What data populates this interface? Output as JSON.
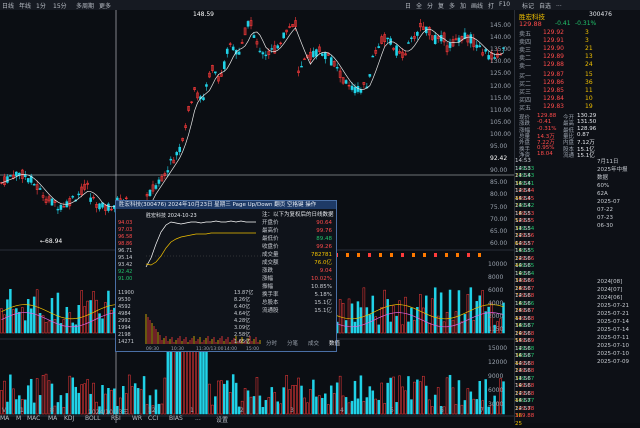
{
  "topbar": {
    "left_items": [
      "日线",
      "年线",
      "1分",
      "15分",
      "多周期",
      "更多"
    ],
    "right_items": [
      "日",
      "全",
      "分",
      "复",
      "多",
      "加",
      "画线",
      "打",
      "F10",
      "标记",
      "自选",
      "..."
    ]
  },
  "main": {
    "price_labels": [
      {
        "text": "148.59",
        "color": "#ffffff"
      },
      {
        "text": "68.94",
        "color": "#ffffff"
      }
    ],
    "axis_labels": [
      "145.00",
      "140.00",
      "135.00",
      "130.00",
      "125.00",
      "120.00",
      "115.00",
      "110.00",
      "105.00",
      "100.00",
      "95.00",
      "92.42",
      "90.00",
      "85.00",
      "80.00",
      "75.00",
      "70.00",
      "65.00",
      "60.00"
    ],
    "vol_axis_labels": [
      "10000",
      "8000",
      "6000",
      "4000",
      "2000",
      "1150"
    ],
    "vol2_axis_labels": [
      "15000",
      "12000",
      "9000",
      "6000",
      "3000"
    ],
    "bottom_labels": [
      "V",
      "1",
      "8",
      "2024/10/23三",
      "12",
      "1",
      "2",
      "3",
      "4",
      "5",
      "6",
      "7"
    ],
    "bottom_tabs": [
      "MA",
      "M",
      "MAC",
      "MA",
      "KDJ",
      "BOLL",
      "RSI",
      "WR",
      "CCI",
      "BIAS",
      "...",
      "设置"
    ]
  },
  "popup": {
    "title": "胜宏科技(300476) 2024年10月23日 星期三 Page Up/Down 翻页 空格键 操作",
    "chart_title": "胜宏科技  2024-10-23",
    "notice": "注：以下为复权后的日线数据",
    "left_values": [
      "94.03",
      "97.03",
      "96.58",
      "98.86",
      "96.71",
      "95.14",
      "93.42",
      "92.42",
      "91.00"
    ],
    "vol_values": [
      "11900",
      "9530",
      "4592",
      "4984",
      "2992",
      "1994",
      "2198",
      "14271"
    ],
    "vol_right": [
      "13.87亿",
      "8.26亿",
      "6.40亿",
      "4.64亿",
      "4.28亿",
      "3.09亿",
      "2.58亿",
      "1.65亿"
    ],
    "x_labels": [
      "09:30",
      "10:30",
      "11:30/13:00",
      "14:00",
      "15:00"
    ],
    "fields": [
      {
        "k": "开盘价",
        "v": "90.64",
        "color": "#ff4b4b"
      },
      {
        "k": "最高价",
        "v": "99.76",
        "color": "#ff4b4b"
      },
      {
        "k": "最低价",
        "v": "89.48",
        "color": "#21c36b"
      },
      {
        "k": "收盘价",
        "v": "99.26",
        "color": "#ff4b4b"
      },
      {
        "k": "成交量",
        "v": "782781",
        "color": "#f0c000"
      },
      {
        "k": "成交额",
        "v": "76.0亿",
        "color": "#f0c000"
      },
      {
        "k": "涨跌",
        "v": "9.04",
        "color": "#ff4b4b"
      },
      {
        "k": "涨幅",
        "v": "10.02%",
        "color": "#ff4b4b"
      },
      {
        "k": "振幅",
        "v": "10.85%",
        "color": "#c8ccd2"
      },
      {
        "k": "换手率",
        "v": "5.18%",
        "color": "#c8ccd2"
      },
      {
        "k": "总股本",
        "v": "15.1亿",
        "color": "#c8ccd2"
      },
      {
        "k": "流通股",
        "v": "15.1亿",
        "color": "#c8ccd2"
      }
    ],
    "tabs": [
      "分时",
      "分笔",
      "成交",
      "数值"
    ]
  },
  "right": {
    "name": "胜宏科技",
    "code": "300476",
    "price": "129.88",
    "change": "-0.41",
    "change_pct": "-0.31%",
    "sells": [
      {
        "l": "卖五",
        "p": "129.92",
        "q": "3"
      },
      {
        "l": "卖四",
        "p": "129.91",
        "q": "3"
      },
      {
        "l": "卖三",
        "p": "129.90",
        "q": "21"
      },
      {
        "l": "卖二",
        "p": "129.89",
        "q": "13"
      },
      {
        "l": "卖一",
        "p": "129.88",
        "q": "24"
      }
    ],
    "buys": [
      {
        "l": "买一",
        "p": "129.87",
        "q": "15"
      },
      {
        "l": "买二",
        "p": "129.86",
        "q": "36"
      },
      {
        "l": "买三",
        "p": "129.85",
        "q": "11"
      },
      {
        "l": "买四",
        "p": "129.84",
        "q": "10"
      },
      {
        "l": "买五",
        "p": "129.83",
        "q": "19"
      }
    ],
    "stats": [
      {
        "k": "现价",
        "v": "129.88",
        "k2": "今开",
        "v2": "130.29"
      },
      {
        "k": "涨跌",
        "v": "-0.41",
        "k2": "最高",
        "v2": "131.50"
      },
      {
        "k": "涨幅",
        "v": "-0.31%",
        "k2": "最低",
        "v2": "128.96"
      },
      {
        "k": "总量",
        "v": "14.3万",
        "k2": "量比",
        "v2": "0.87"
      },
      {
        "k": "外盘",
        "v": "7.22万",
        "k2": "内盘",
        "v2": "7.12万"
      },
      {
        "k": "换手",
        "v": "0.95%",
        "k2": "股本",
        "v2": "15.1亿"
      },
      {
        "k": "净资",
        "v": "18.04",
        "k2": "流通",
        "v2": "15.1亿"
      }
    ],
    "trades": [
      {
        "t": "14:53",
        "p": "129.83",
        "v": "21",
        "c": "#21c36b"
      },
      {
        "t": "14:53",
        "p": "129.83",
        "v": "38",
        "c": "#21c36b"
      },
      {
        "t": "14:54",
        "p": "129.81",
        "v": "12",
        "c": "#21c36b"
      },
      {
        "t": "14:54",
        "p": "129.84",
        "v": "45",
        "c": "#ff4b4b"
      },
      {
        "t": "14:54",
        "p": "129.85",
        "v": "23",
        "c": "#ff4b4b"
      },
      {
        "t": "14:54",
        "p": "129.82",
        "v": "18",
        "c": "#21c36b"
      },
      {
        "t": "14:54",
        "p": "129.83",
        "v": "52",
        "c": "#ff4b4b"
      },
      {
        "t": "14:55",
        "p": "129.85",
        "v": "31",
        "c": "#ff4b4b"
      },
      {
        "t": "14:55",
        "p": "129.84",
        "v": "27",
        "c": "#21c36b"
      },
      {
        "t": "14:55",
        "p": "129.86",
        "v": "64",
        "c": "#ff4b4b"
      },
      {
        "t": "14:55",
        "p": "129.87",
        "v": "15",
        "c": "#ff4b4b"
      },
      {
        "t": "14:55",
        "p": "129.85",
        "v": "22",
        "c": "#21c36b"
      },
      {
        "t": "14:55",
        "p": "129.86",
        "v": "40",
        "c": "#ff4b4b"
      },
      {
        "t": "14:56",
        "p": "129.85",
        "v": "19",
        "c": "#21c36b"
      },
      {
        "t": "14:56",
        "p": "129.84",
        "v": "33",
        "c": "#21c36b"
      },
      {
        "t": "14:56",
        "p": "129.86",
        "v": "28",
        "c": "#ff4b4b"
      },
      {
        "t": "14:56",
        "p": "129.87",
        "v": "72",
        "c": "#ff4b4b"
      },
      {
        "t": "14:56",
        "p": "129.88",
        "v": "16",
        "c": "#ff4b4b"
      },
      {
        "t": "14:56",
        "p": "129.86",
        "v": "25",
        "c": "#21c36b"
      },
      {
        "t": "14:56",
        "p": "129.87",
        "v": "41",
        "c": "#ff4b4b"
      },
      {
        "t": "14:56",
        "p": "129.88",
        "v": "38",
        "c": "#ff4b4b"
      },
      {
        "t": "14:56",
        "p": "129.87",
        "v": "29",
        "c": "#21c36b"
      },
      {
        "t": "14:56",
        "p": "129.88",
        "v": "55",
        "c": "#ff4b4b"
      },
      {
        "t": "14:56",
        "p": "129.89",
        "v": "17",
        "c": "#ff4b4b"
      },
      {
        "t": "14:56",
        "p": "129.88",
        "v": "36",
        "c": "#21c36b"
      },
      {
        "t": "14:56",
        "p": "129.87",
        "v": "44",
        "c": "#21c36b"
      },
      {
        "t": "14:56",
        "p": "129.88",
        "v": "23",
        "c": "#ff4b4b"
      },
      {
        "t": "14:56",
        "p": "129.88",
        "v": "31",
        "c": "#ff4b4b"
      },
      {
        "t": "14:56",
        "p": "129.87",
        "v": "19",
        "c": "#21c36b"
      },
      {
        "t": "14:56",
        "p": "129.88",
        "v": "27",
        "c": "#ff4b4b"
      },
      {
        "t": "14:56",
        "p": "129.88",
        "v": "48",
        "c": "#ff4b4b"
      },
      {
        "t": "14:56",
        "p": "129.87",
        "v": "22",
        "c": "#21c36b"
      },
      {
        "t": "14:57",
        "p": "129.88",
        "v": "36",
        "c": "#ff4b4b"
      },
      {
        "t": "14:57",
        "p": "129.88",
        "v": "25",
        "c": "#ff4b4b"
      }
    ],
    "dates": [
      "7月11日",
      "2025年中报",
      "数据",
      "60%",
      "62A",
      "2025-07",
      "07-22",
      "07-23",
      "06-30",
      "",
      "",
      "",
      "",
      "",
      "",
      "2024[08]",
      "2024[07]",
      "2024[06]",
      "2025-07-21",
      "2025-07-21",
      "2025-07-14",
      "2025-07-14",
      "2025-07-11",
      "2025-07-10",
      "2025-07-10",
      "2025-07-09"
    ]
  }
}
